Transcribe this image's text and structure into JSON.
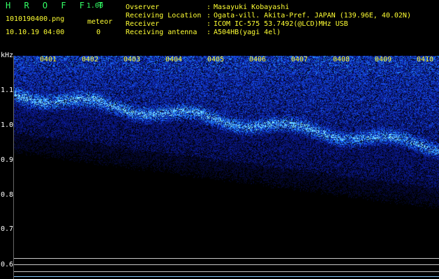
{
  "header": {
    "title": "H R O F F T",
    "version": "1.00",
    "file_name": "1010190400.png",
    "meteor_label": "meteor",
    "datetime": "10.10.19 04:00",
    "meteor_count": "0"
  },
  "info": [
    {
      "label": "Ovserver",
      "value": "Masayuki Kobayashi"
    },
    {
      "label": "Receiving Location",
      "value": "Ogata-vill. Akita-Pref. JAPAN (139.96E, 40.02N)"
    },
    {
      "label": "Receiver",
      "value": "ICOM IC-575 53.7492(@LCD)MHz USB"
    },
    {
      "label": "Receiving antenna",
      "value": "A504HB(yagi 4el)"
    }
  ],
  "colon": ":",
  "axis": {
    "unit": "kHz",
    "y_ticks": [
      "1.1",
      "1.0",
      "0.9",
      "0.8",
      "0.7",
      "0.6"
    ],
    "x_ticks": [
      "0401",
      "0402",
      "0403",
      "0404",
      "0405",
      "0406",
      "0407",
      "0408",
      "0409",
      "0410"
    ]
  },
  "colors": {
    "header_text": "#ffff33",
    "title_text": "#33ff66",
    "signal_low": "#0a1a8a",
    "signal_mid": "#2a6cff",
    "signal_high": "#9bf0ff",
    "background": "#000000"
  }
}
